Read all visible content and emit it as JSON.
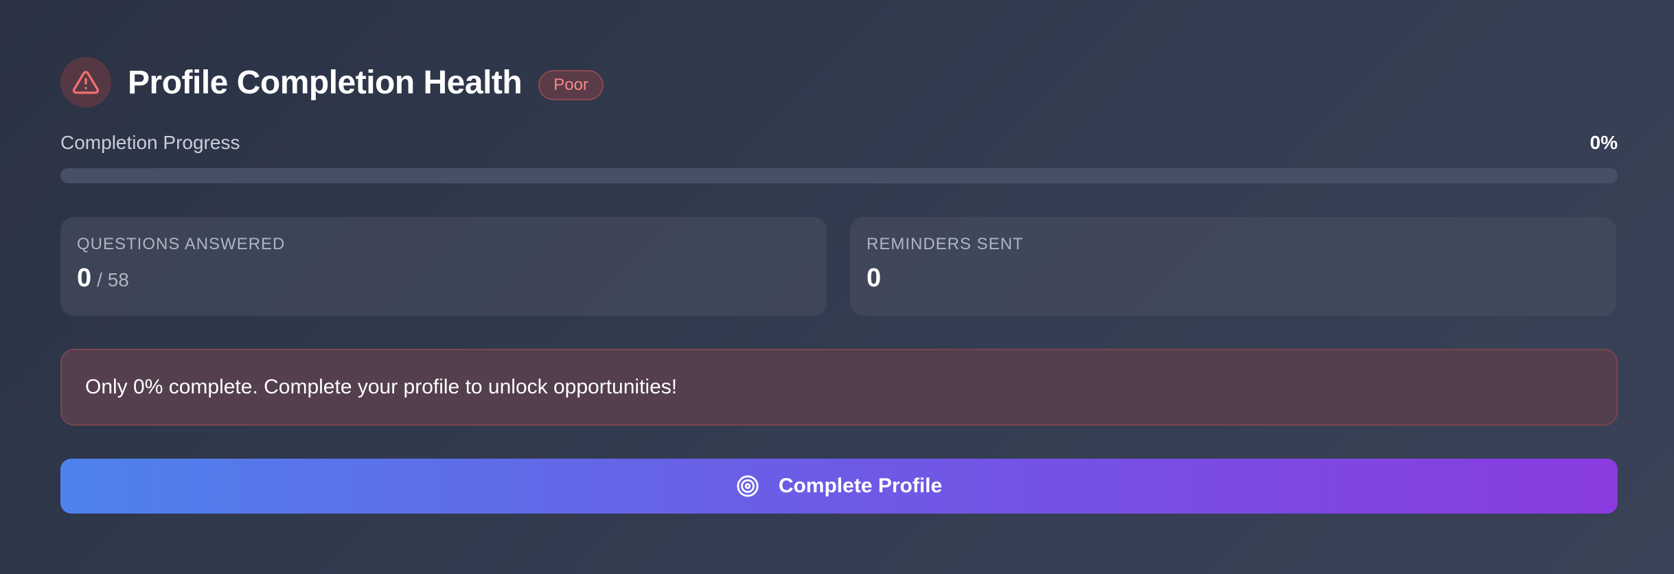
{
  "header": {
    "title": "Profile Completion Health",
    "status_badge": "Poor",
    "icon": "alert-triangle-icon"
  },
  "progress": {
    "label": "Completion Progress",
    "value_text": "0%",
    "percent": 0
  },
  "stats": {
    "questions": {
      "label": "QUESTIONS ANSWERED",
      "value": "0",
      "total": "/ 58"
    },
    "reminders": {
      "label": "REMINDERS SENT",
      "value": "0"
    }
  },
  "warning": {
    "message": "Only 0% complete. Complete your profile to unlock opportunities!"
  },
  "cta": {
    "label": "Complete Profile",
    "icon": "target-icon"
  },
  "colors": {
    "danger": "#f58a8a",
    "gradient_start": "#4f82ec",
    "gradient_end": "#8a3be0"
  }
}
